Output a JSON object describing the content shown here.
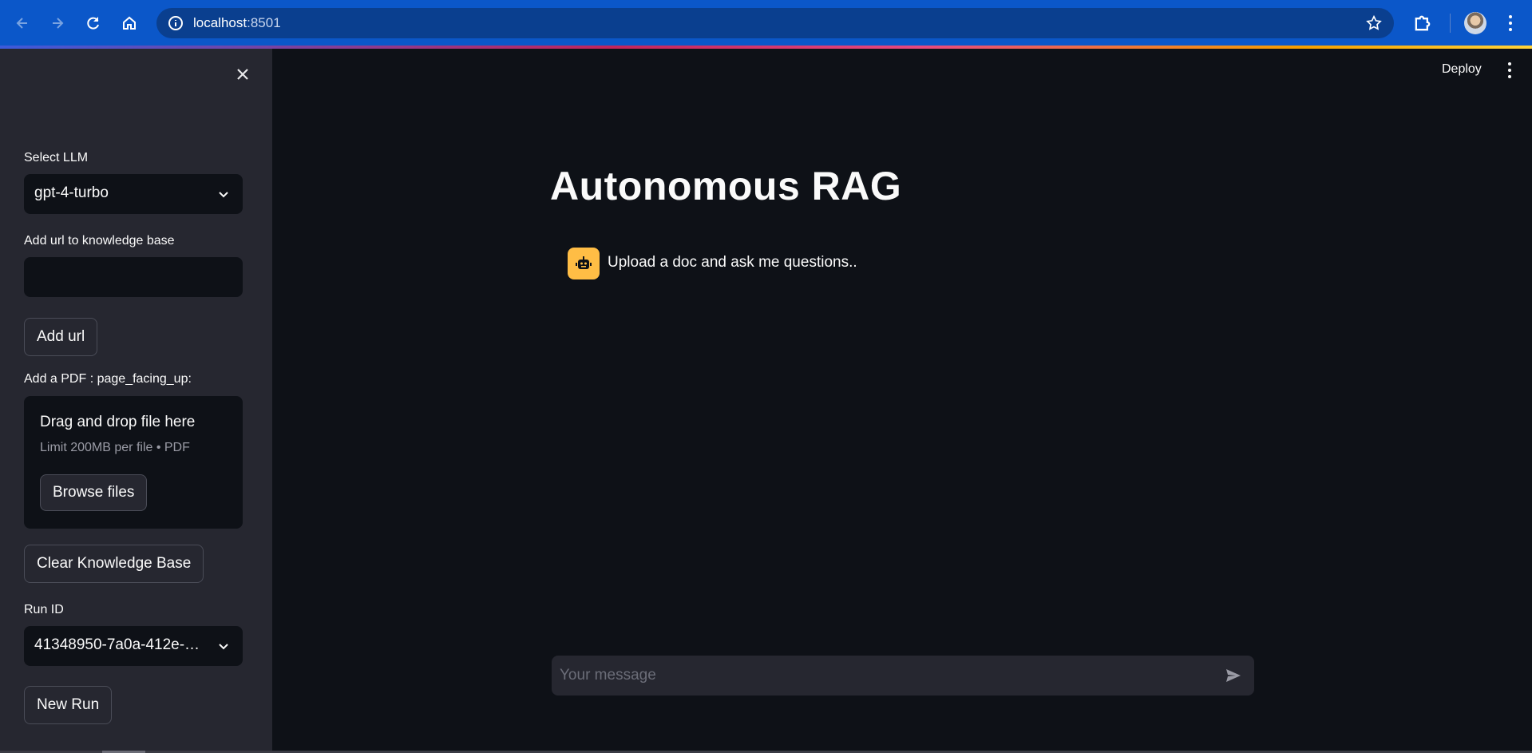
{
  "browser": {
    "url_host": "localhost",
    "url_port": ":8501"
  },
  "sidebar": {
    "select_llm_label": "Select LLM",
    "select_llm_value": "gpt-4-turbo",
    "add_url_label": "Add url to knowledge base",
    "add_url_value": "",
    "add_url_button": "Add url",
    "add_pdf_label": "Add a PDF : page_facing_up:",
    "dropzone_title": "Drag and drop file here",
    "dropzone_hint": "Limit 200MB per file • PDF",
    "browse_button": "Browse files",
    "clear_button": "Clear Knowledge Base",
    "run_id_label": "Run ID",
    "run_id_value": "41348950-7a0a-412e-…",
    "new_run_button": "New Run"
  },
  "header": {
    "deploy_label": "Deploy"
  },
  "main": {
    "title": "Autonomous RAG",
    "assistant_message": "Upload a doc and ask me questions..",
    "chat_placeholder": "Your message"
  },
  "colors": {
    "background": "#0e1117",
    "sidebar": "#262730",
    "browser_bar": "#0b57c9",
    "bot_avatar": "#ffbd45"
  }
}
